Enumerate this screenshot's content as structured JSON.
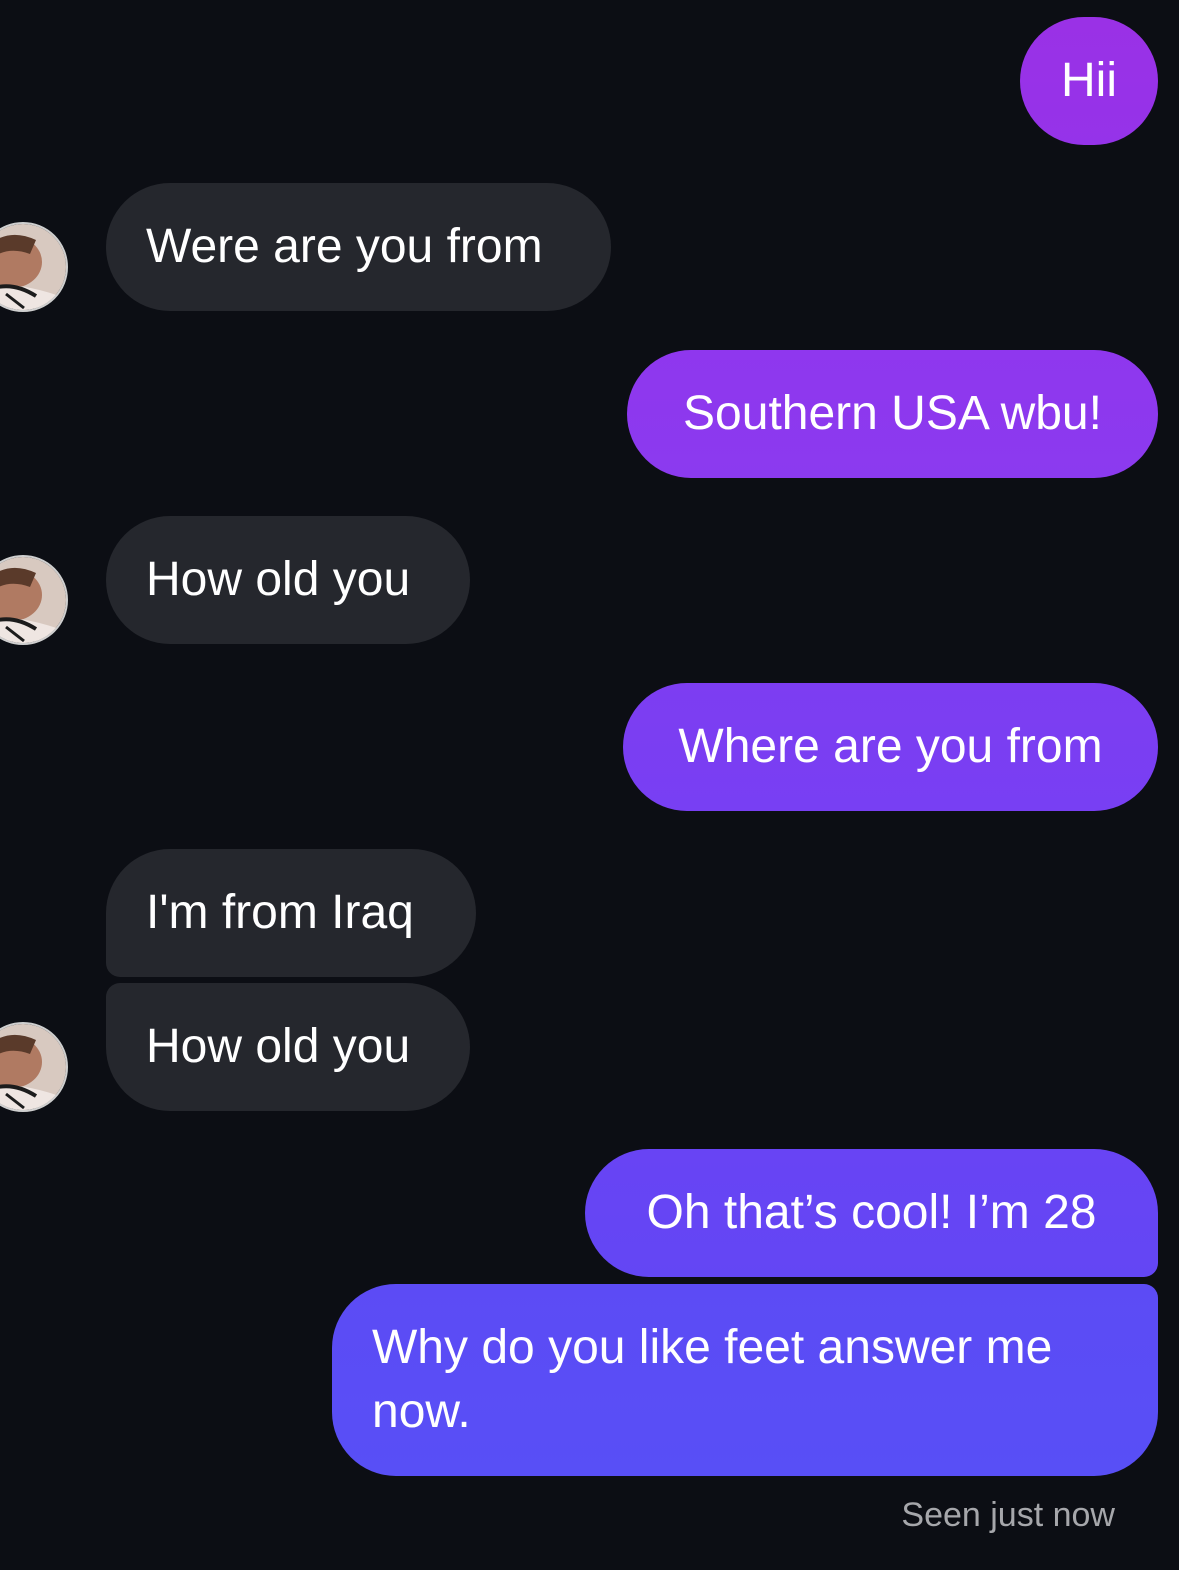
{
  "conversation": {
    "messages": [
      {
        "sender": "me",
        "text": "Hii"
      },
      {
        "sender": "them",
        "text": "Were are you from"
      },
      {
        "sender": "me",
        "text": "Southern USA wbu!"
      },
      {
        "sender": "them",
        "text": "How old you"
      },
      {
        "sender": "me",
        "text": "Where are you from"
      },
      {
        "sender": "them",
        "text": "I'm from Iraq"
      },
      {
        "sender": "them",
        "text": "How old you"
      },
      {
        "sender": "me",
        "text": "Oh that’s cool! I’m 28"
      },
      {
        "sender": "me",
        "text": "Why do you like feet answer me now."
      }
    ],
    "status": "Seen just now"
  },
  "colors": {
    "background": "#0c0e14",
    "incoming_bubble": "#25272d",
    "outgoing_top": "#9a31e6",
    "outgoing_bottom": "#5a4ff5"
  },
  "icons": {
    "avatar": "contact-avatar-photo"
  }
}
